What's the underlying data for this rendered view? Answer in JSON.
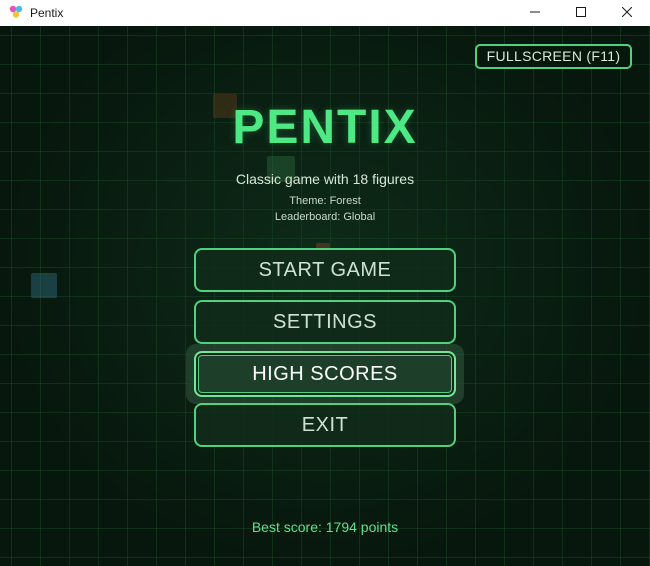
{
  "window": {
    "title": "Pentix",
    "icon": "pentix-app-icon",
    "controls": [
      "minimize-icon",
      "maximize-icon",
      "close-icon"
    ]
  },
  "game": {
    "fullscreen_label": "FULLSCREEN (F11)",
    "logo": "PENTIX",
    "subtitle": "Classic game with 18 figures",
    "theme": "Theme: Forest",
    "leaderboard": "Leaderboard: Global",
    "menu": {
      "start": "START GAME",
      "settings": "SETTINGS",
      "high_scores": "HIGH SCORES",
      "exit": "EXIT"
    },
    "selected_item": "high_scores",
    "best_score": "Best score: 1794 points"
  },
  "colors": {
    "background": "#07170d",
    "grid": "#1f5a33",
    "accent": "#4ee884",
    "button_border": "#4fd17f",
    "text": "#d6ecd9"
  }
}
